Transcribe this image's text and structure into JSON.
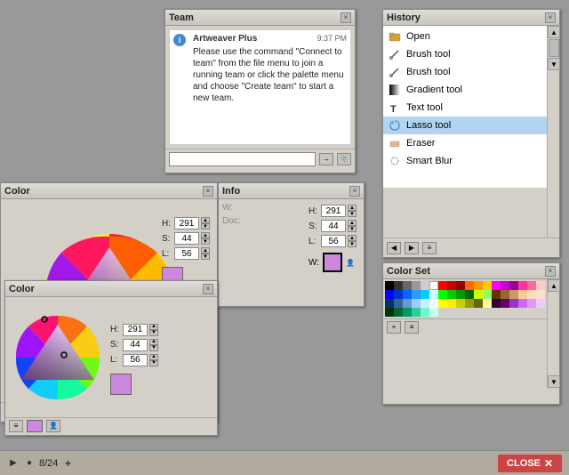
{
  "app": {
    "title": "Artweaver Plus"
  },
  "history_panel": {
    "title": "History",
    "items": [
      {
        "id": "open",
        "label": "Open",
        "icon": "folder"
      },
      {
        "id": "brush1",
        "label": "Brush tool",
        "icon": "brush"
      },
      {
        "id": "brush2",
        "label": "Brush tool",
        "icon": "brush"
      },
      {
        "id": "gradient",
        "label": "Gradient tool",
        "icon": "gradient"
      },
      {
        "id": "text",
        "label": "Text tool",
        "icon": "text"
      },
      {
        "id": "lasso",
        "label": "Lasso tool",
        "icon": "lasso",
        "selected": true
      },
      {
        "id": "eraser",
        "label": "Eraser",
        "icon": "eraser"
      },
      {
        "id": "smartblur",
        "label": "Smart Blur",
        "icon": "blur"
      }
    ],
    "footer_buttons": [
      "triangle-left",
      "triangle-right",
      "menu"
    ]
  },
  "colorset_panel": {
    "title": "Color Set"
  },
  "team_panel": {
    "title": "Team",
    "message": {
      "sender": "Artweaver Plus",
      "time": "9:37 PM",
      "body": "Please use the command \"Connect to team\" from the file menu to join a running team or click the palette menu and choose \"Create team\" to start a new team."
    }
  },
  "color_panel_large": {
    "title": "Color",
    "h_value": "291",
    "s_value": "44",
    "l_value": "56"
  },
  "color_panel_small": {
    "title": "Color",
    "h_value": "291",
    "s_value": "44",
    "l_value": "56"
  },
  "info_panel": {
    "title": "Info"
  },
  "bottom_bar": {
    "play_label": "▶",
    "circle_label": "●",
    "frame_text": "8/24",
    "plus_label": "+",
    "close_label": "CLOSE"
  }
}
